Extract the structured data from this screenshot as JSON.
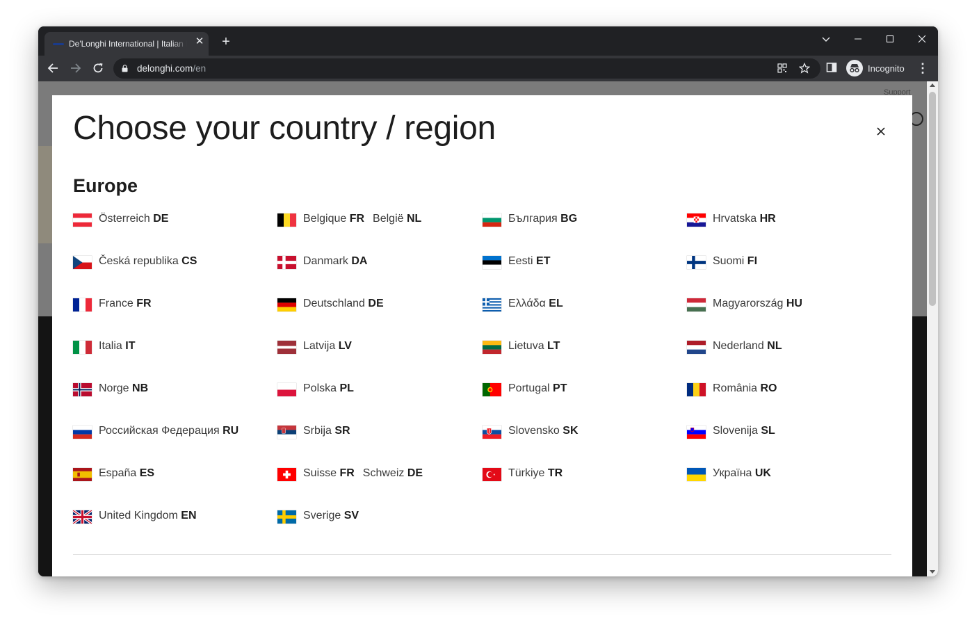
{
  "browser": {
    "tab_title": "De'Longhi International | Italian H",
    "url_host": "delonghi.com",
    "url_path": "/en",
    "profile_label": "Incognito",
    "icons": [
      "back-icon",
      "forward-icon",
      "reload-icon",
      "lock-icon",
      "qr-code-icon",
      "bookmark-star-icon",
      "side-panel-icon",
      "incognito-icon",
      "kebab-menu-icon",
      "minimize-icon",
      "maximize-icon",
      "close-icon",
      "new-tab-icon",
      "tab-search-icon"
    ]
  },
  "background_page": {
    "support_label": "Support"
  },
  "modal": {
    "title": "Choose your country / region",
    "close_icon": "close-icon",
    "region": "Europe",
    "countries": [
      {
        "flag": "AT",
        "langs": [
          {
            "name": "Österreich",
            "code": "DE"
          }
        ]
      },
      {
        "flag": "BE",
        "langs": [
          {
            "name": "Belgique",
            "code": "FR"
          },
          {
            "name": "België",
            "code": "NL"
          }
        ]
      },
      {
        "flag": "BG",
        "langs": [
          {
            "name": "България",
            "code": "BG"
          }
        ]
      },
      {
        "flag": "HR",
        "langs": [
          {
            "name": "Hrvatska",
            "code": "HR"
          }
        ]
      },
      {
        "flag": "CZ",
        "langs": [
          {
            "name": "Česká republika",
            "code": "CS"
          }
        ]
      },
      {
        "flag": "DK",
        "langs": [
          {
            "name": "Danmark",
            "code": "DA"
          }
        ]
      },
      {
        "flag": "EE",
        "langs": [
          {
            "name": "Eesti",
            "code": "ET"
          }
        ]
      },
      {
        "flag": "FI",
        "langs": [
          {
            "name": "Suomi",
            "code": "FI"
          }
        ]
      },
      {
        "flag": "FR",
        "langs": [
          {
            "name": "France",
            "code": "FR"
          }
        ]
      },
      {
        "flag": "DE",
        "langs": [
          {
            "name": "Deutschland",
            "code": "DE"
          }
        ]
      },
      {
        "flag": "GR",
        "langs": [
          {
            "name": "Ελλάδα",
            "code": "EL"
          }
        ]
      },
      {
        "flag": "HU",
        "langs": [
          {
            "name": "Magyarország",
            "code": "HU"
          }
        ]
      },
      {
        "flag": "IT",
        "langs": [
          {
            "name": "Italia",
            "code": "IT"
          }
        ]
      },
      {
        "flag": "LV",
        "langs": [
          {
            "name": "Latvija",
            "code": "LV"
          }
        ]
      },
      {
        "flag": "LT",
        "langs": [
          {
            "name": "Lietuva",
            "code": "LT"
          }
        ]
      },
      {
        "flag": "NL",
        "langs": [
          {
            "name": "Nederland",
            "code": "NL"
          }
        ]
      },
      {
        "flag": "NO",
        "langs": [
          {
            "name": "Norge",
            "code": "NB"
          }
        ]
      },
      {
        "flag": "PL",
        "langs": [
          {
            "name": "Polska",
            "code": "PL"
          }
        ]
      },
      {
        "flag": "PT",
        "langs": [
          {
            "name": "Portugal",
            "code": "PT"
          }
        ]
      },
      {
        "flag": "RO",
        "langs": [
          {
            "name": "România",
            "code": "RO"
          }
        ]
      },
      {
        "flag": "RU",
        "langs": [
          {
            "name": "Российская Федерация",
            "code": "RU"
          }
        ]
      },
      {
        "flag": "RS",
        "langs": [
          {
            "name": "Srbija",
            "code": "SR"
          }
        ]
      },
      {
        "flag": "SK",
        "langs": [
          {
            "name": "Slovensko",
            "code": "SK"
          }
        ]
      },
      {
        "flag": "SI",
        "langs": [
          {
            "name": "Slovenija",
            "code": "SL"
          }
        ]
      },
      {
        "flag": "ES",
        "langs": [
          {
            "name": "España",
            "code": "ES"
          }
        ]
      },
      {
        "flag": "CH",
        "langs": [
          {
            "name": "Suisse",
            "code": "FR"
          },
          {
            "name": "Schweiz",
            "code": "DE"
          }
        ]
      },
      {
        "flag": "TR",
        "langs": [
          {
            "name": "Türkiye",
            "code": "TR"
          }
        ]
      },
      {
        "flag": "UA",
        "langs": [
          {
            "name": "Україна",
            "code": "UK"
          }
        ]
      },
      {
        "flag": "GB",
        "langs": [
          {
            "name": "United Kingdom",
            "code": "EN"
          }
        ]
      },
      {
        "flag": "SE",
        "langs": [
          {
            "name": "Sverige",
            "code": "SV"
          }
        ]
      }
    ]
  }
}
